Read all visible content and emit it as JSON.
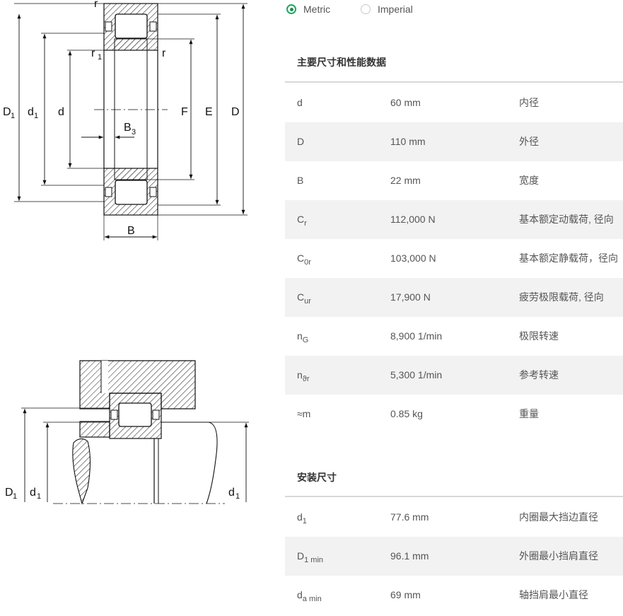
{
  "drawing": {
    "top_labels": {
      "r_top": "r",
      "r1": "r",
      "r1_sub": "1",
      "r_right": "r",
      "D1": "D",
      "D1_sub": "1",
      "d1": "d",
      "d1_sub": "1",
      "d": "d",
      "B3": "B",
      "B3_sub": "3",
      "F": "F",
      "E": "E",
      "D": "D",
      "B": "B"
    },
    "bottom_labels": {
      "D1": "D",
      "D1_sub": "1",
      "d1_left": "d",
      "d1_left_sub": "1",
      "d1_right": "d",
      "d1_right_sub": "1"
    }
  },
  "unit_toggle": {
    "options": [
      {
        "label": "Metric",
        "checked": true
      },
      {
        "label": "Imperial",
        "checked": false
      }
    ]
  },
  "sections": [
    {
      "title": "主要尺寸和性能数据",
      "rows": [
        {
          "sym": "d",
          "sub": "",
          "value": "60 mm",
          "desc": "内径"
        },
        {
          "sym": "D",
          "sub": "",
          "value": "110 mm",
          "desc": "外径"
        },
        {
          "sym": "B",
          "sub": "",
          "value": "22 mm",
          "desc": "宽度"
        },
        {
          "sym": "C",
          "sub": "r",
          "value": "112,000 N",
          "desc": "基本额定动载荷, 径向"
        },
        {
          "sym": "C",
          "sub": "0r",
          "value": "103,000 N",
          "desc": "基本额定静载荷，径向"
        },
        {
          "sym": "C",
          "sub": "ur",
          "value": "17,900 N",
          "desc": "疲劳极限载荷, 径向"
        },
        {
          "sym": "n",
          "sub": "G",
          "value": "8,900 1/min",
          "desc": "极限转速"
        },
        {
          "sym": "n",
          "sub": "ϑr",
          "value": "5,300 1/min",
          "desc": "参考转速"
        },
        {
          "sym": "≈m",
          "sub": "",
          "value": "0.85 kg",
          "desc": "重量"
        }
      ]
    },
    {
      "title": "安装尺寸",
      "rows": [
        {
          "sym": "d",
          "sub": "1",
          "value": "77.6 mm",
          "desc": "内圈最大挡边直径"
        },
        {
          "sym": "D",
          "sub": "1 min",
          "value": "96.1 mm",
          "desc": "外圈最小挡肩直径"
        },
        {
          "sym": "d",
          "sub": "a min",
          "value": "69 mm",
          "desc": "轴挡肩最小直径"
        }
      ]
    }
  ],
  "colors": {
    "accent_green": "#23a560",
    "row_alt_bg": "#f2f2f2",
    "rule": "#d8d8d8"
  }
}
